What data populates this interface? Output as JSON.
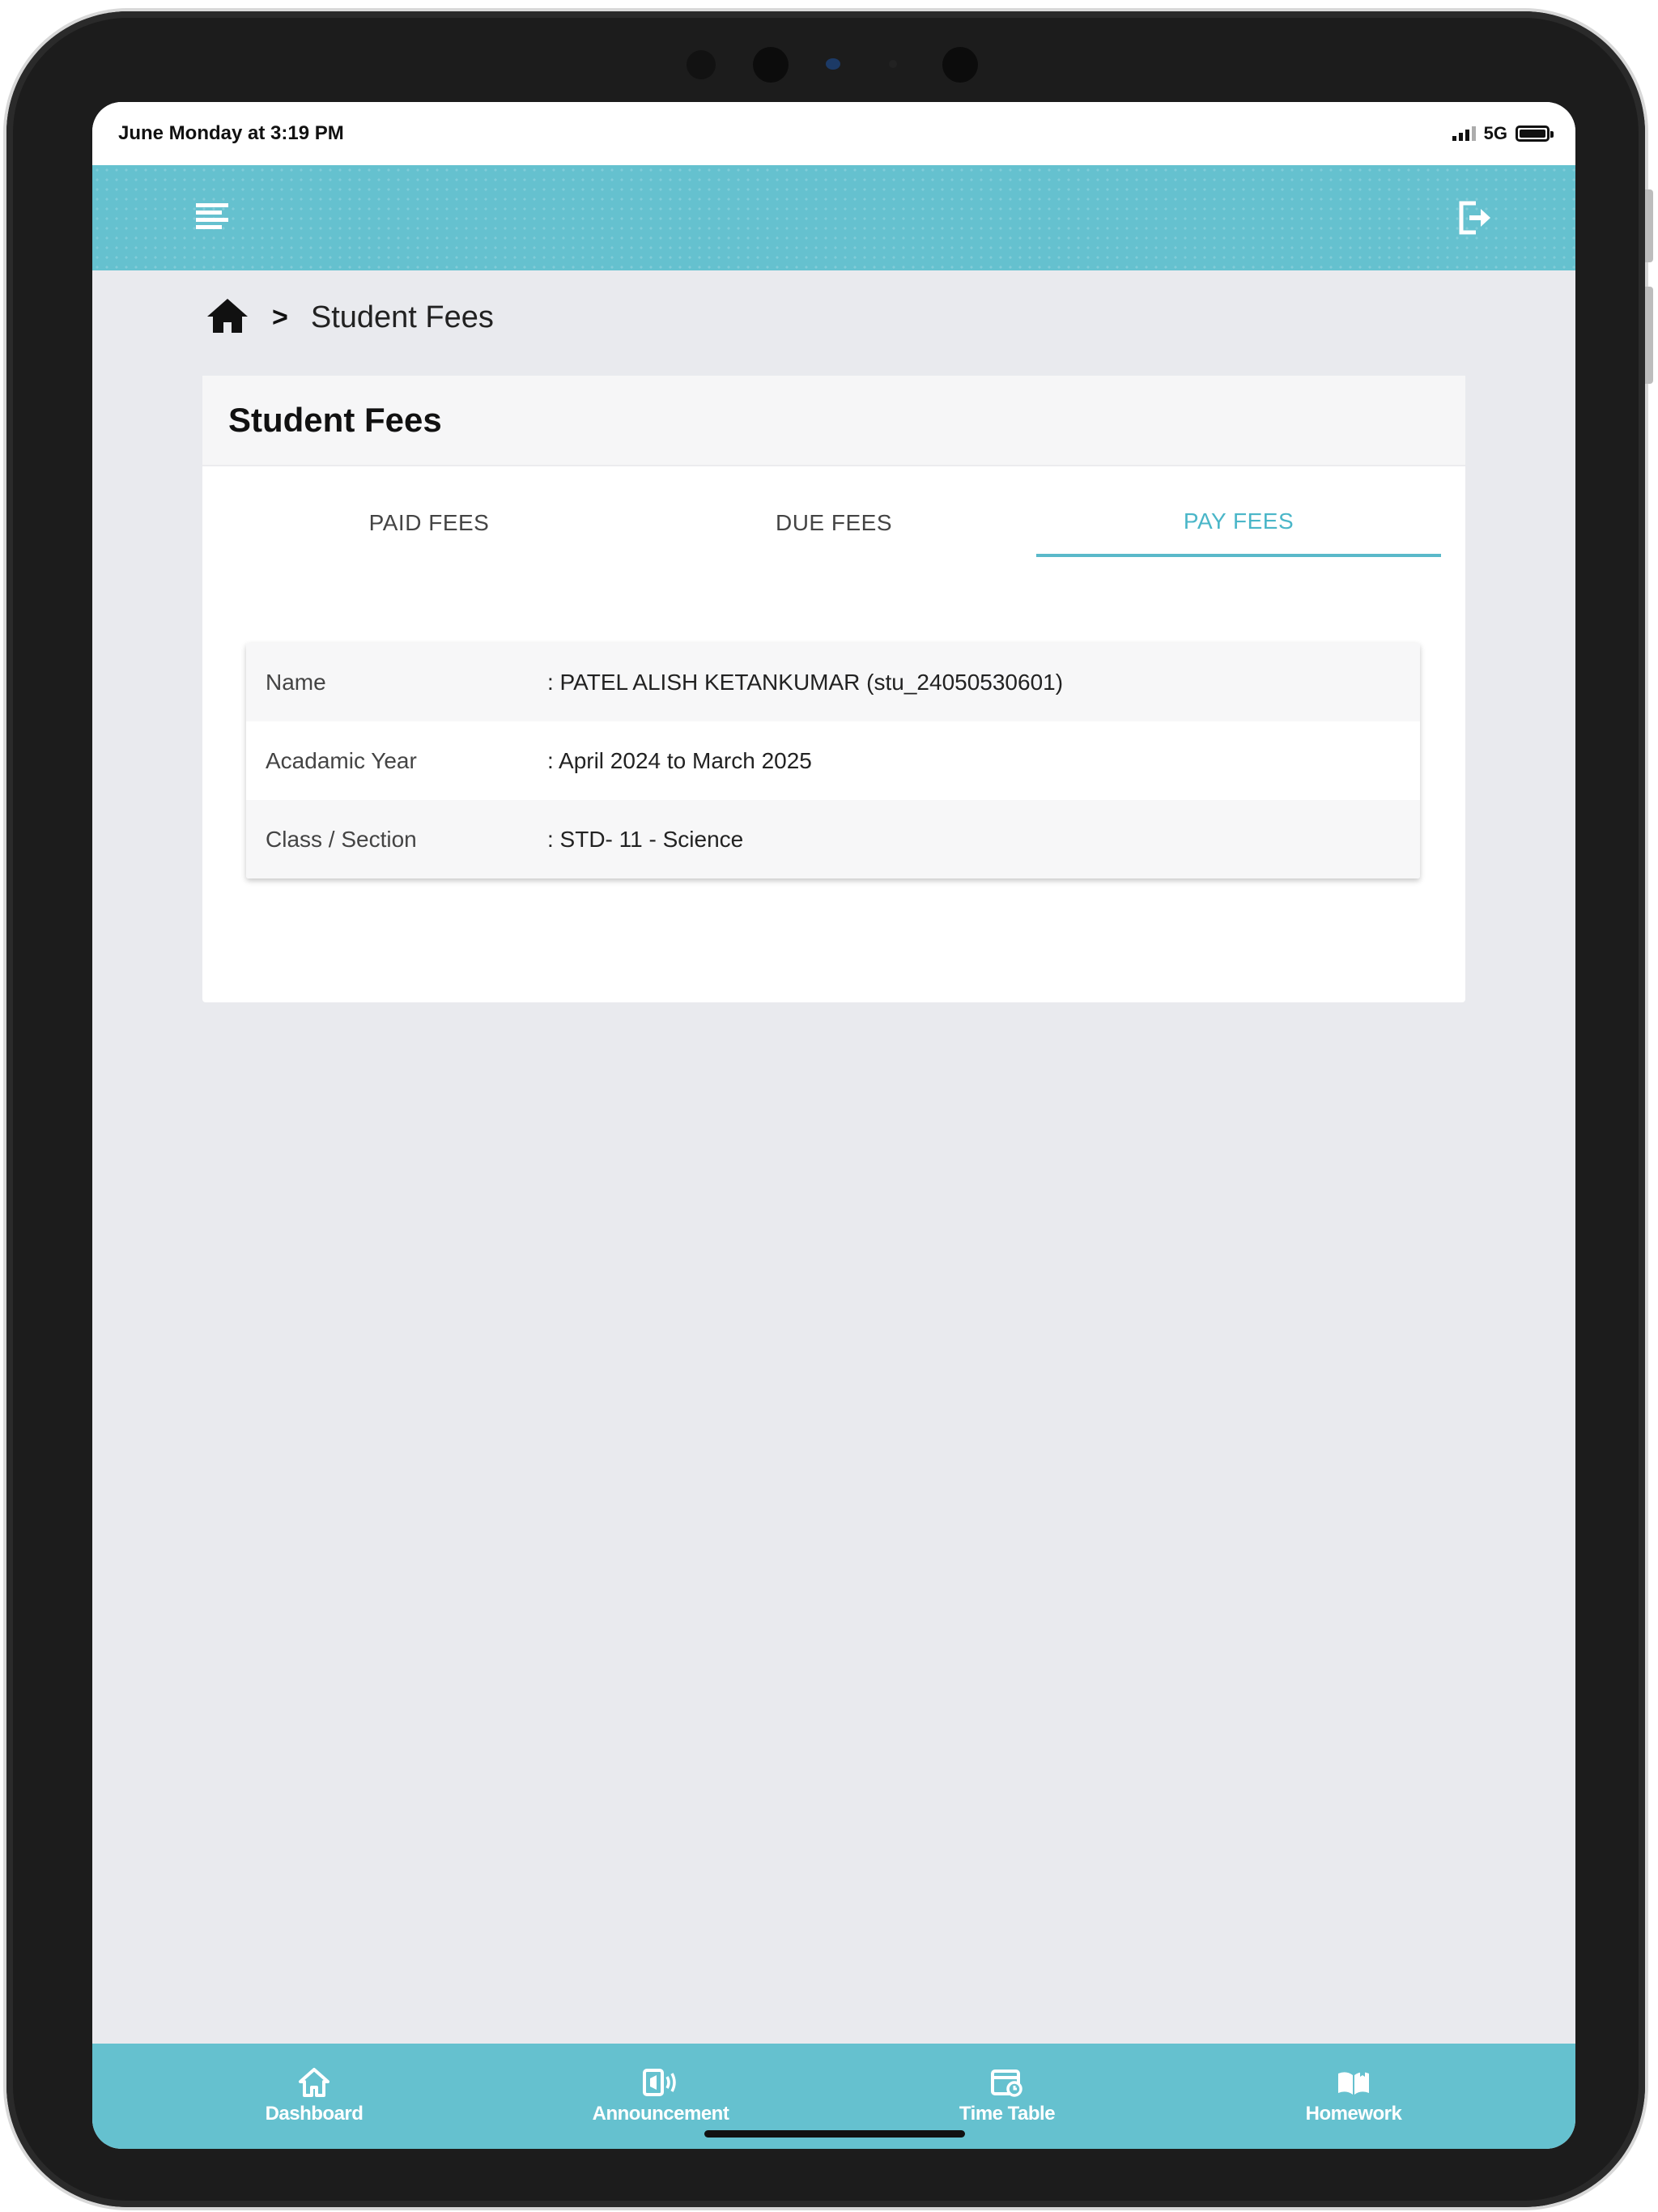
{
  "status_bar": {
    "time": "June Monday at 3:19 PM",
    "network": "5G"
  },
  "app_bar": {
    "menu_icon": "menu-icon",
    "logout_icon": "logout-icon",
    "color": "#65c1cf"
  },
  "breadcrumb": {
    "home_icon": "home-icon",
    "separator": ">",
    "current": "Student Fees"
  },
  "card": {
    "title": "Student Fees",
    "tabs": [
      {
        "label": "PAID FEES",
        "active": false
      },
      {
        "label": "DUE FEES",
        "active": false
      },
      {
        "label": "PAY FEES",
        "active": true
      }
    ],
    "info": [
      {
        "label": "Name",
        "value": ": PATEL ALISH KETANKUMAR (stu_24050530601)"
      },
      {
        "label": "Acadamic Year",
        "value": ": April 2024 to March 2025"
      },
      {
        "label": "Class / Section",
        "value": ": STD- 11 - Science"
      }
    ]
  },
  "bottom_nav": {
    "items": [
      {
        "label": "Dashboard",
        "icon": "dashboard-icon"
      },
      {
        "label": "Announcement",
        "icon": "announcement-icon"
      },
      {
        "label": "Time Table",
        "icon": "timetable-icon"
      },
      {
        "label": "Homework",
        "icon": "homework-icon"
      }
    ]
  },
  "colors": {
    "accent": "#65c1cf",
    "active_tab": "#4ab6c8",
    "background": "#e9eaee"
  }
}
